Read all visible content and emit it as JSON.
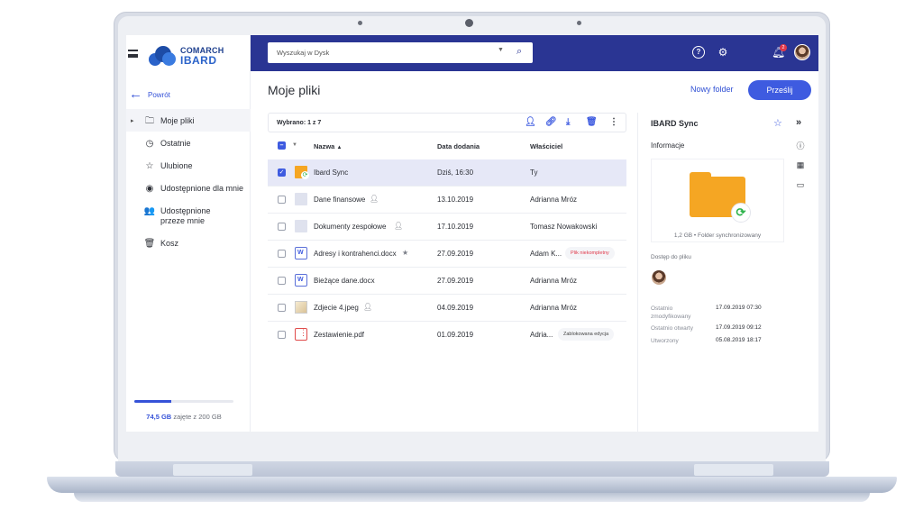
{
  "app": {
    "logo_line1": "COMARCH",
    "logo_line2": "IBARD",
    "back_label": "Powrót"
  },
  "sidebar": {
    "items": [
      {
        "label": "Moje pliki",
        "icon": "folder-outline-icon",
        "active": true
      },
      {
        "label": "Ostatnie",
        "icon": "clock-icon"
      },
      {
        "label": "Ulubione",
        "icon": "star-outline-icon"
      },
      {
        "label": "Udostępnione dla mnie",
        "icon": "shared-with-me-icon"
      },
      {
        "label": "Udostępnione przeze mnie",
        "icon": "shared-by-me-icon"
      },
      {
        "label": "Kosz",
        "icon": "trash-icon"
      }
    ],
    "storage": {
      "used": "74,5 GB",
      "suffix": "zajęte z 200 GB",
      "fraction": 0.3725
    }
  },
  "topbar": {
    "search_placeholder": "Wyszukaj w Dysk",
    "notification_count": "2"
  },
  "main": {
    "title": "Moje pliki",
    "new_folder_label": "Nowy folder",
    "upload_label": "Prześlij",
    "selection_text": "Wybrano: 1 z 7",
    "columns": {
      "name": "Nazwa",
      "date": "Data dodania",
      "owner": "Właściciel"
    },
    "rows": [
      {
        "name": "Ibard Sync",
        "date": "Dziś, 16:30",
        "owner": "Ty",
        "type": "sync-folder",
        "selected": true
      },
      {
        "name": "Dane finansowe",
        "date": "13.10.2019",
        "owner": "Adrianna Mróz",
        "type": "folder"
      },
      {
        "name": "Dokumenty zespołowe",
        "date": "17.10.2019",
        "owner": "Tomasz Nowakowski",
        "type": "folder"
      },
      {
        "name": "Adresy i kontrahenci.docx",
        "date": "27.09.2019",
        "owner": "Adam K...",
        "type": "doc",
        "tag": "Plik niekompletny"
      },
      {
        "name": "Bieżące dane.docx",
        "date": "27.09.2019",
        "owner": "Adrianna Mróz",
        "type": "doc"
      },
      {
        "name": "Zdjecie 4.jpeg",
        "date": "04.09.2019",
        "owner": "Adrianna Mróz",
        "type": "image"
      },
      {
        "name": "Zestawienie.pdf",
        "date": "01.09.2019",
        "owner": "Adria...",
        "type": "pdf",
        "tag": "Zablokowana edycja"
      }
    ]
  },
  "panel": {
    "title": "IBARD Sync",
    "info_label": "Informacje",
    "size": "1,2 GB",
    "status": "Folder synchronizowany",
    "access_label": "Dostęp do pliku",
    "details": [
      {
        "key": "Ostatnio zmodyfikowany",
        "value": "17.09.2019  07:30"
      },
      {
        "key": "Ostatnio otwarty",
        "value": "17.09.2019  09:12"
      },
      {
        "key": "Utworzony",
        "value": "05.08.2019  18:17"
      }
    ]
  },
  "colors": {
    "topbar": "#2a3593",
    "accent": "#3e5be0",
    "folder": "#f5a623",
    "sync": "#2fb34c",
    "warning_tag": "#e0384a"
  }
}
